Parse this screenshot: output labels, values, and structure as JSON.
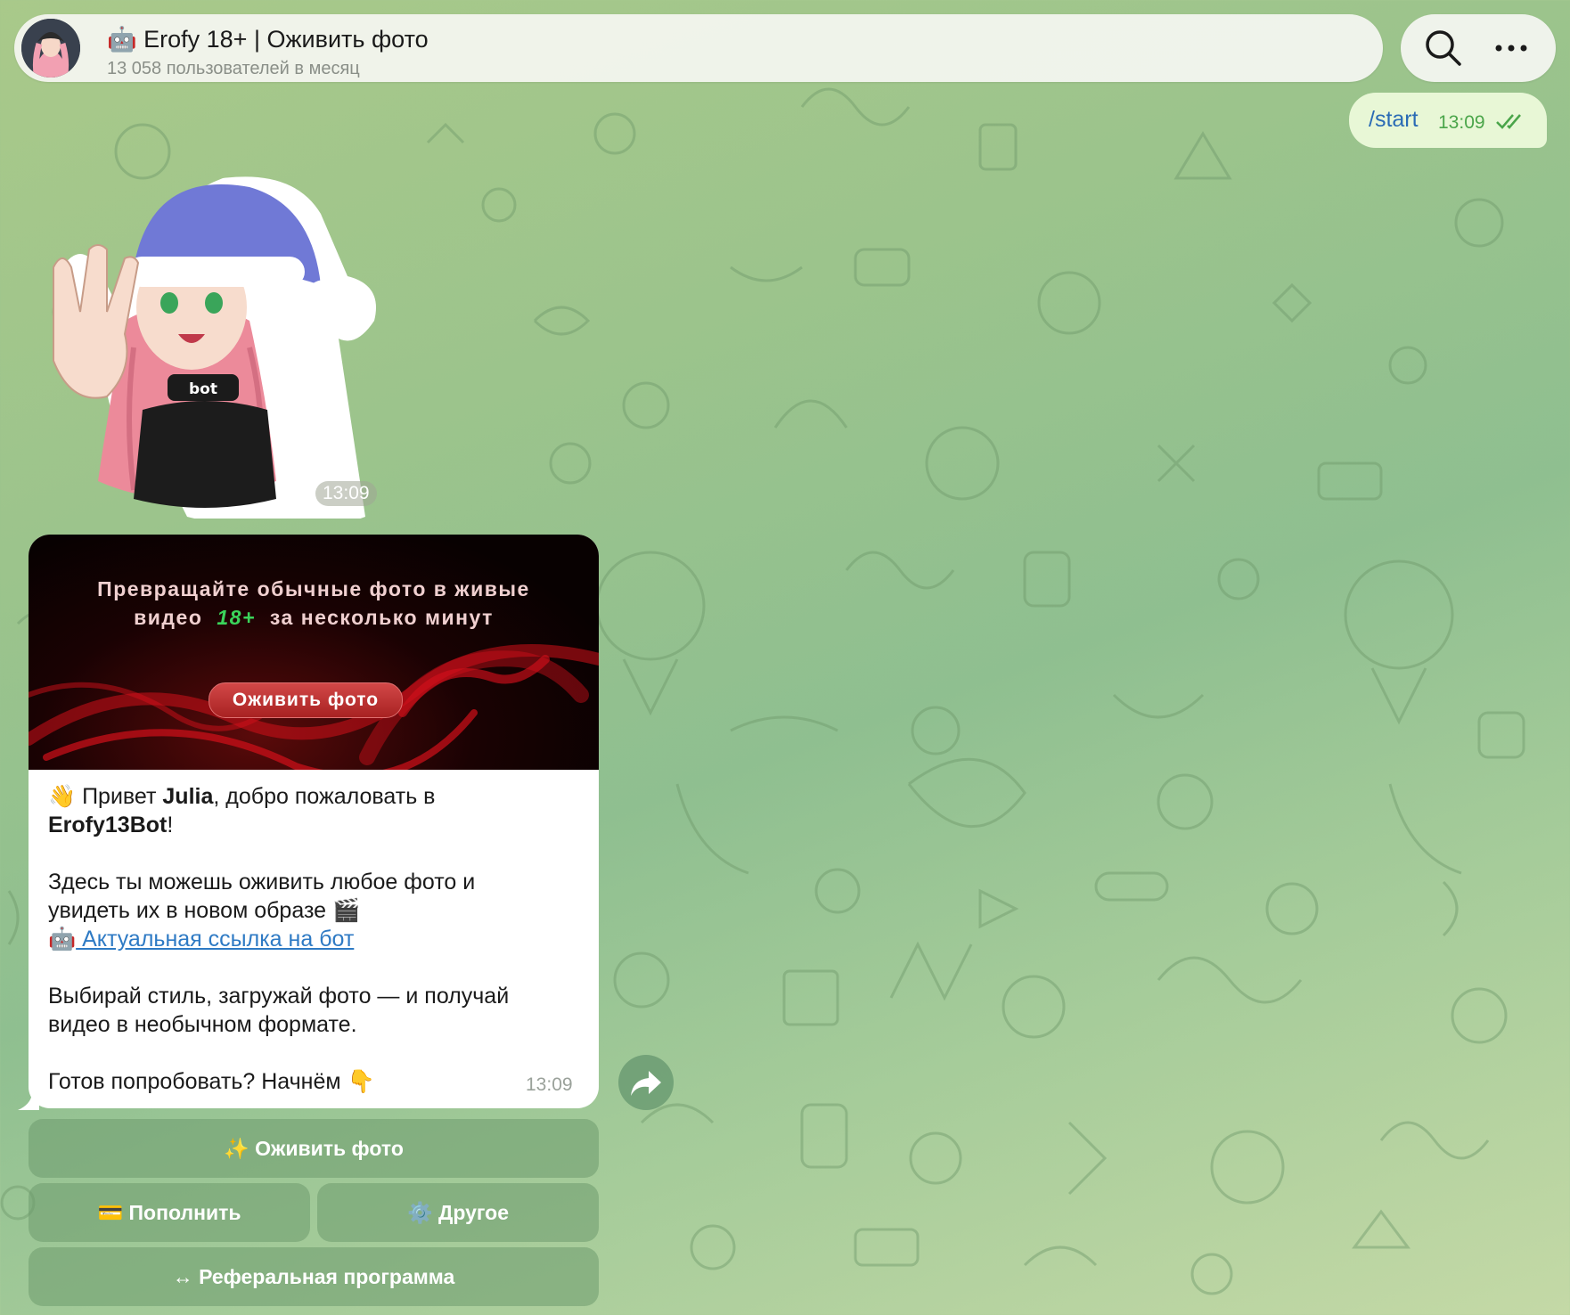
{
  "header": {
    "title": "🤖 Erofy 18+ | Оживить фото",
    "subtitle": "13 058 пользователей в месяц"
  },
  "outgoing": {
    "text": "/start",
    "time": "13:09"
  },
  "sticker": {
    "collar_text": "bot",
    "time": "13:09"
  },
  "banner": {
    "line1": "Превращайте обычные фото в живые",
    "line2_start": "видео",
    "line2_badge": "18+",
    "line2_end": "за несколько минут",
    "button": "Оживить фото"
  },
  "message": {
    "greet_emoji": "👋",
    "greet_1": " Привет ",
    "greet_name": "Julia",
    "greet_2": ", добро пожаловать в",
    "bot_name": "Erofy13Bot",
    "greet_3": "!",
    "p2_line1": "Здесь ты можешь оживить любое фото и",
    "p2_line2": "увидеть их в новом образе 🎬",
    "link_emoji": "🤖",
    "link_text": " Актуальная ссылка на бот",
    "p3_line1": "Выбирай стиль, загружай фото — и получай",
    "p3_line2": "видео в необычном формате.",
    "p4": "Готов попробовать? Начнём 👇",
    "time": "13:09"
  },
  "keyboard": {
    "animate": "✨ Оживить фото",
    "topup": "💳 Пополнить",
    "other": "⚙️ Другое",
    "referral": "↔ Реферальная программа"
  },
  "icons": [
    "search-icon",
    "more-icon",
    "double-check-icon",
    "share-icon"
  ],
  "colors": {
    "link": "#2e7ac4",
    "outgoing_bg": "#e8f7d6",
    "outgoing_text": "#2a6bb5",
    "check": "#4aa54a"
  }
}
